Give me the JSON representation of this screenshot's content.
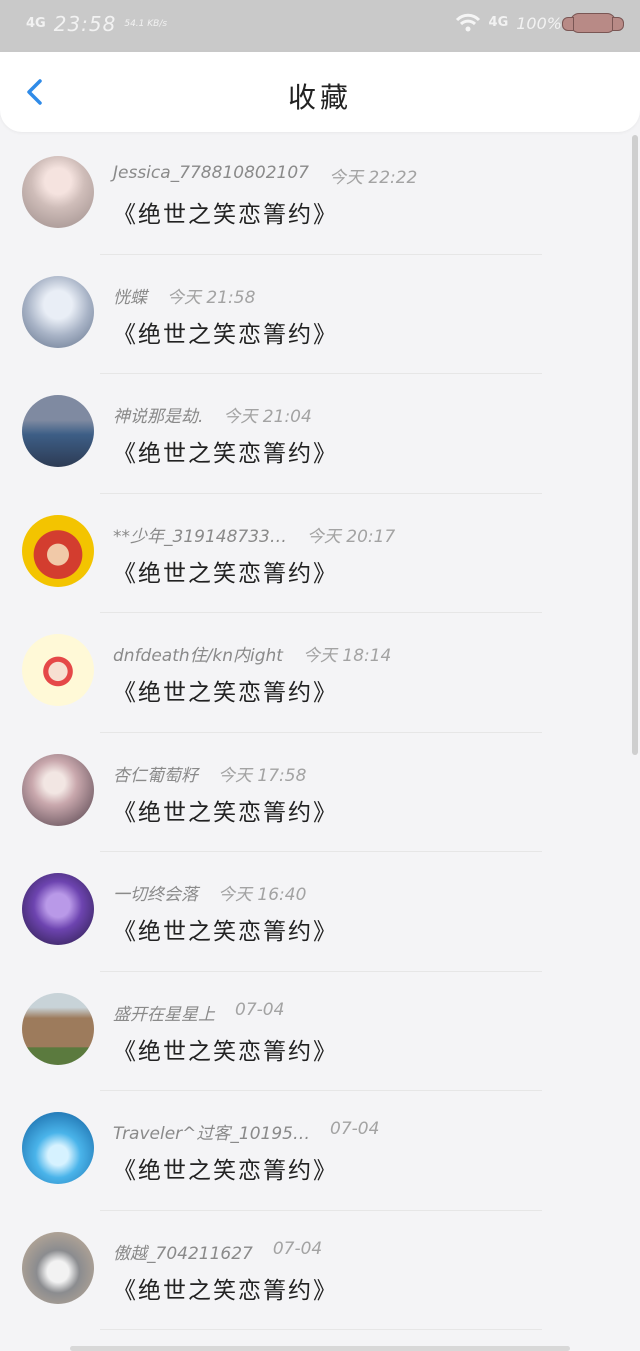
{
  "status_bar": {
    "network": "4G",
    "time": "23:58",
    "speed": "54.1\nKB/s",
    "network_right": "4G",
    "battery": "100%"
  },
  "header": {
    "title": "收藏"
  },
  "favorites": [
    {
      "user": "Jessica_778810802107",
      "time": "今天 22:22",
      "book": "《绝世之笑恋箐约》"
    },
    {
      "user": "恍蝶",
      "time": "今天 21:58",
      "book": "《绝世之笑恋箐约》"
    },
    {
      "user": "神说那是劫.",
      "time": "今天 21:04",
      "book": "《绝世之笑恋箐约》"
    },
    {
      "user": "**少年_319148733…",
      "time": "今天 20:17",
      "book": "《绝世之笑恋箐约》"
    },
    {
      "user": "dnfdeath住/kn内ight",
      "time": "今天 18:14",
      "book": "《绝世之笑恋箐约》"
    },
    {
      "user": "杏仁葡萄籽",
      "time": "今天 17:58",
      "book": "《绝世之笑恋箐约》"
    },
    {
      "user": "一切终会落",
      "time": "今天 16:40",
      "book": "《绝世之笑恋箐约》"
    },
    {
      "user": "盛开在星星上",
      "time": "07-04",
      "book": "《绝世之笑恋箐约》"
    },
    {
      "user": "Traveler^过客_10195…",
      "time": "07-04",
      "book": "《绝世之笑恋箐约》"
    },
    {
      "user": "傲越_704211627",
      "time": "07-04",
      "book": "《绝世之笑恋箐约》"
    }
  ],
  "colors": {
    "accent": "#2f8be8",
    "status_bar": "#c9c9c9"
  }
}
